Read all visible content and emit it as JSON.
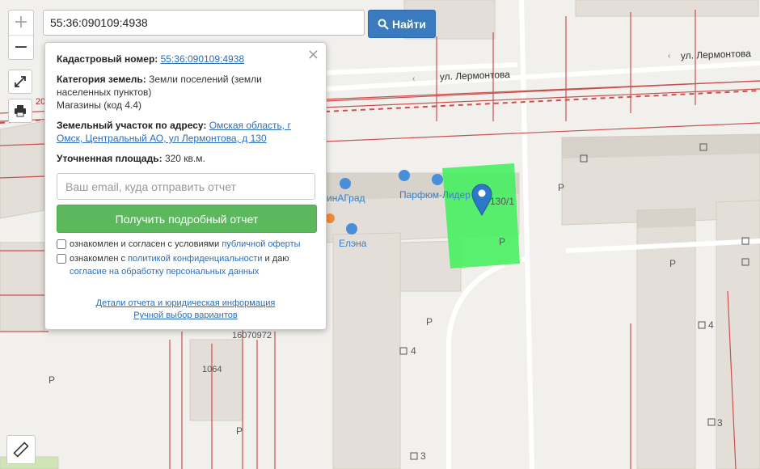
{
  "search": {
    "value": "55:36:090109:4938",
    "button_label": "Найти"
  },
  "controls": {
    "zoom_in": "+",
    "zoom_out": "−"
  },
  "popup": {
    "close": "×",
    "cadastral_label": "Кадастровый номер:",
    "cadastral_value": "55:36:090109:4938",
    "category_label": "Категория земель:",
    "category_value": "Земли поселений (земли населенных пунктов)",
    "use_value": "Магазины (код 4.4)",
    "address_label": "Земельный участок по адресу:",
    "address_value": "Омская область, г Омск, Центральный АО, ул Лермонтова, д 130",
    "area_label": "Уточненная площадь:",
    "area_value": "320 кв.м.",
    "email_placeholder": "Ваш email, куда отправить отчет",
    "report_button": "Получить подробный отчет",
    "consent1_text": "ознакомлен и согласен с условиями",
    "consent1_link": "публичной оферты",
    "consent2_text": "ознакомлен с",
    "consent2_link1": "политикой конфиденциальности",
    "consent2_mid": "и даю",
    "consent2_link2": "согласие на обработку персональных данных",
    "details_link": "Детали отчета и юридическая информация",
    "manual_link": "Ручной выбор вариантов"
  },
  "map": {
    "street_1": "ул. Лермонтова",
    "street_2": "ул. Лермонтова",
    "poi_1": "инАГрад",
    "poi_2": "Парфюм-Лидер",
    "poi_3": "Елэна",
    "house_130": "130/1",
    "num_1064": "1064",
    "num_16070972": "16070972",
    "num_20": "20",
    "parking": "P",
    "num_4a": "4",
    "num_4b": "4",
    "num_3a": "3",
    "num_3b": "3",
    "colors": {
      "parcel": "#3ef05a",
      "marker": "#2f78c8",
      "boundary": "#c43c3c"
    }
  }
}
